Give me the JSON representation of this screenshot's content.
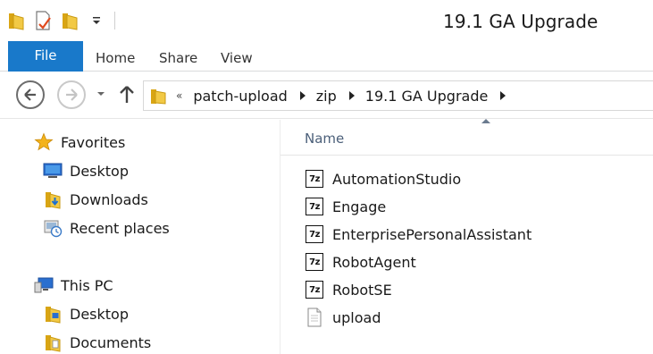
{
  "window": {
    "title": "19.1 GA Upgrade",
    "quick_access_icons": [
      "folder-icon",
      "properties-icon",
      "new-folder-icon",
      "customize-dropdown-icon"
    ]
  },
  "ribbon": {
    "tabs": [
      {
        "label": "File",
        "active": true
      },
      {
        "label": "Home"
      },
      {
        "label": "Share"
      },
      {
        "label": "View"
      }
    ],
    "accent_color": "#1979ca"
  },
  "address": {
    "overflow": "«",
    "crumbs": [
      "patch-upload",
      "zip",
      "19.1 GA Upgrade"
    ]
  },
  "nav": {
    "favorites": {
      "label": "Favorites",
      "items": [
        {
          "label": "Desktop",
          "icon": "desktop-icon"
        },
        {
          "label": "Downloads",
          "icon": "downloads-icon"
        },
        {
          "label": "Recent places",
          "icon": "recent-places-icon"
        }
      ]
    },
    "this_pc": {
      "label": "This PC",
      "items": [
        {
          "label": "Desktop",
          "icon": "desktop-folder-icon"
        },
        {
          "label": "Documents",
          "icon": "documents-icon"
        }
      ]
    }
  },
  "files": {
    "column_header": "Name",
    "items": [
      {
        "name": "AutomationStudio",
        "icon": "7z-archive-icon",
        "badge": "7z"
      },
      {
        "name": "Engage",
        "icon": "7z-archive-icon",
        "badge": "7z"
      },
      {
        "name": "EnterprisePersonalAssistant",
        "icon": "7z-archive-icon",
        "badge": "7z"
      },
      {
        "name": "RobotAgent",
        "icon": "7z-archive-icon",
        "badge": "7z"
      },
      {
        "name": "RobotSE",
        "icon": "7z-archive-icon",
        "badge": "7z"
      },
      {
        "name": "upload",
        "icon": "text-file-icon"
      }
    ]
  }
}
